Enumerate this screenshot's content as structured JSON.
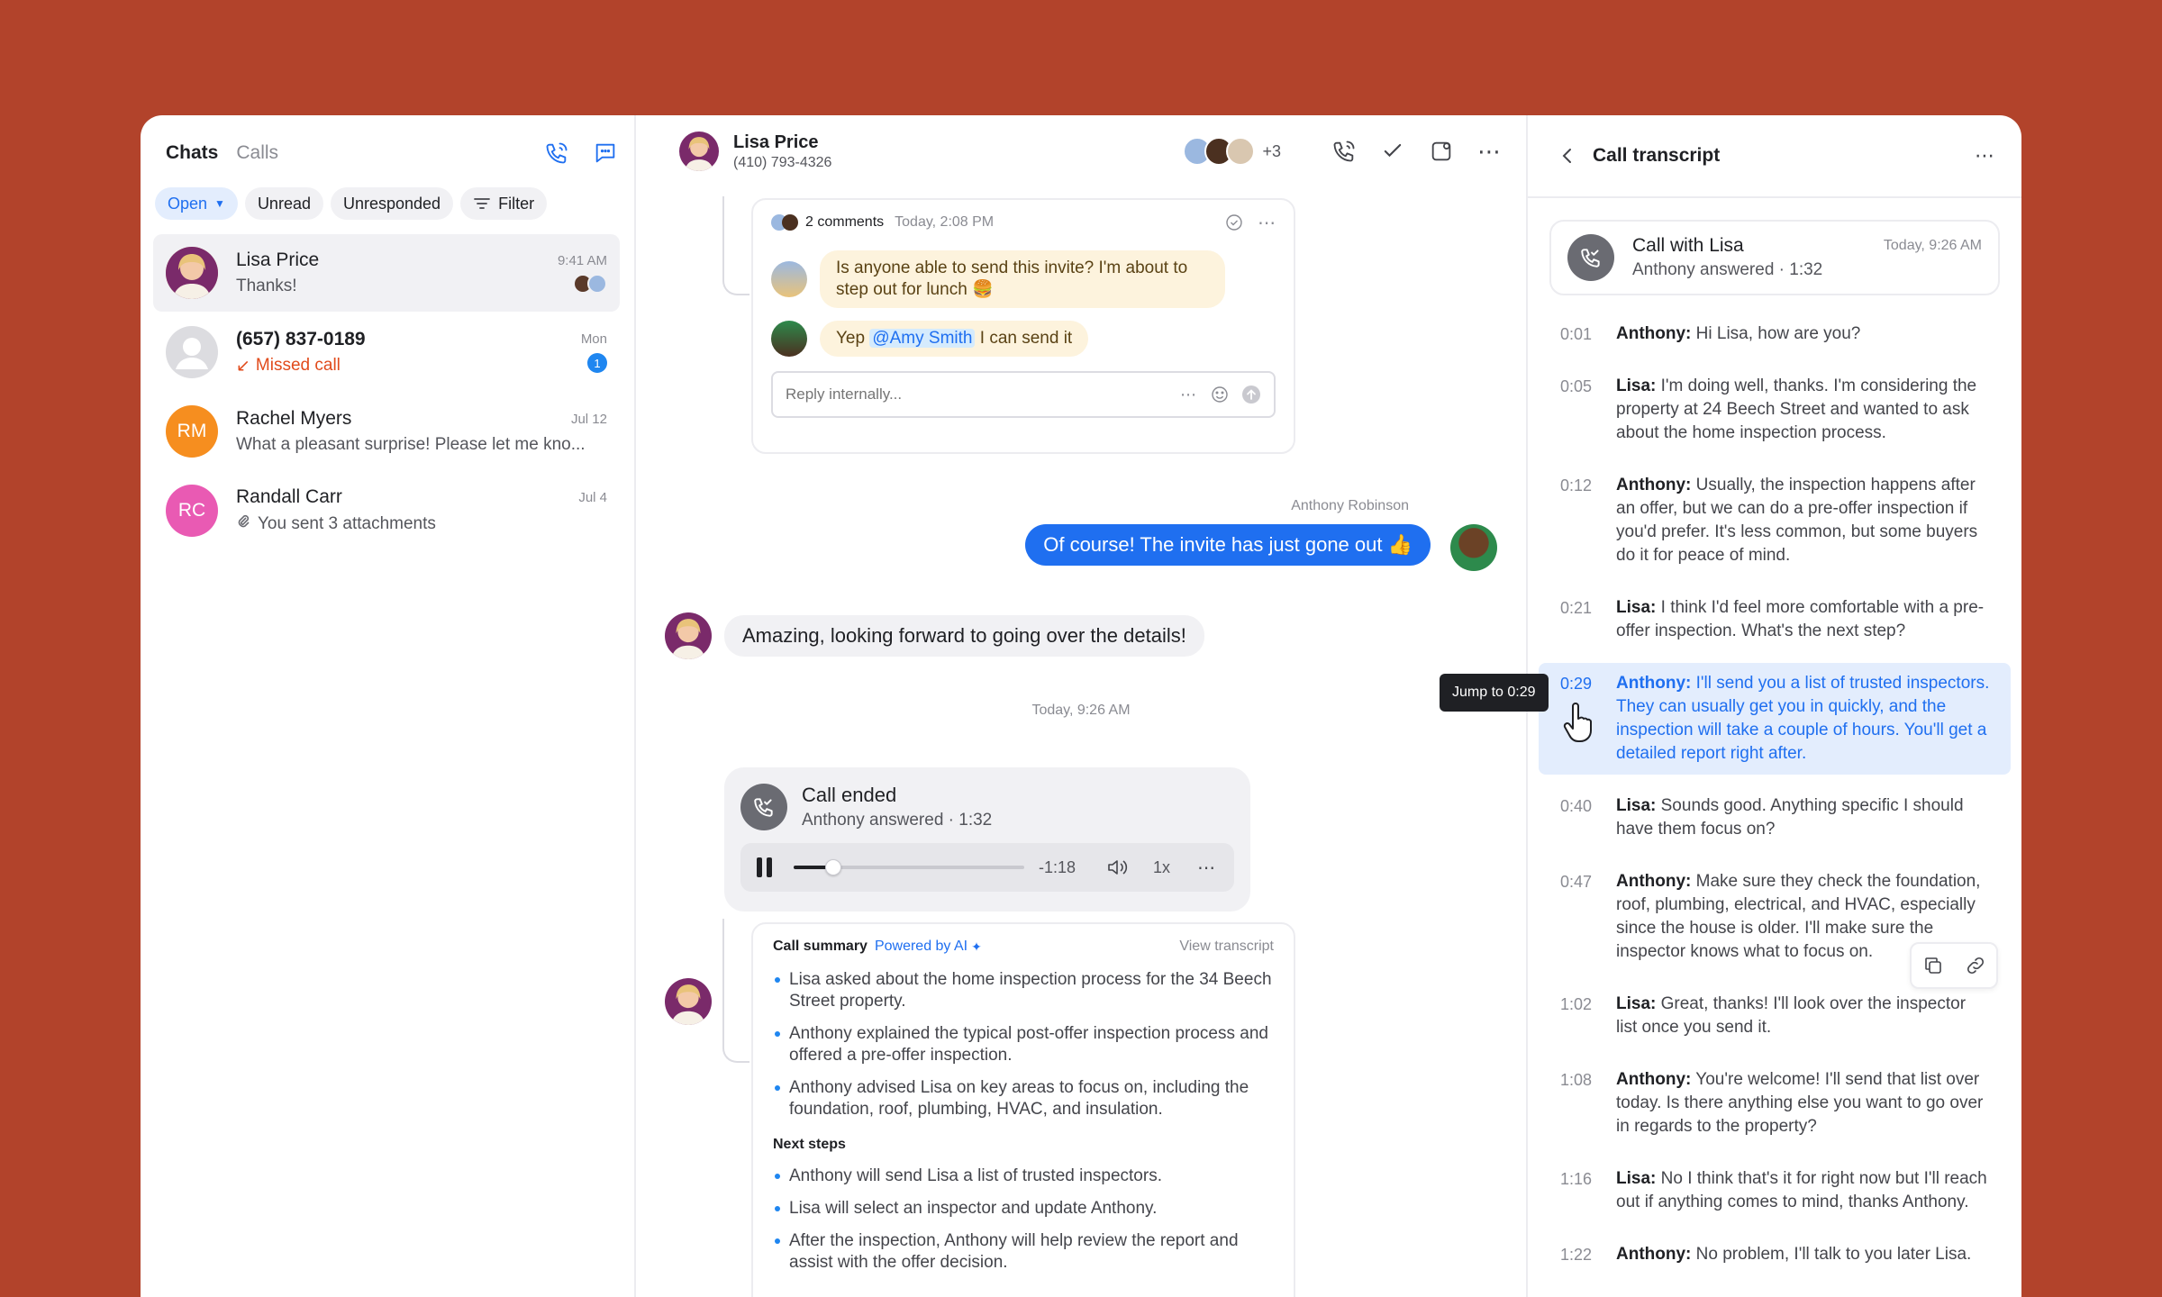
{
  "sidebar": {
    "tabs": [
      {
        "label": "Chats"
      },
      {
        "label": "Calls"
      }
    ],
    "filters": [
      {
        "label": "Open"
      },
      {
        "label": "Unread"
      },
      {
        "label": "Unresponded"
      },
      {
        "label": "Filter"
      }
    ],
    "conversations": [
      {
        "name": "Lisa Price",
        "time": "9:41 AM",
        "preview": "Thanks!"
      },
      {
        "name": "(657) 837-0189",
        "time": "Mon",
        "preview": "Missed call",
        "badge": "1"
      },
      {
        "name": "Rachel Myers",
        "initials": "RM",
        "time": "Jul 12",
        "preview": "What a pleasant surprise! Please let me kno..."
      },
      {
        "name": "Randall Carr",
        "initials": "RC",
        "time": "Jul 4",
        "preview": "You sent 3 attachments"
      }
    ]
  },
  "chat": {
    "contact_name": "Lisa Price",
    "contact_phone": "(410) 793-4326",
    "participants_more": "+3",
    "comments": {
      "count_label": "2 comments",
      "time": "Today, 2:08 PM",
      "items": [
        {
          "text": "Is anyone able to send this invite? I'm about to step out for lunch 🍔"
        },
        {
          "pre": "Yep ",
          "mention": "@Amy Smith",
          "post": " I can send it"
        }
      ],
      "reply_placeholder": "Reply internally..."
    },
    "outgoing_sender": "Anthony Robinson",
    "outgoing_message": "Of course! The invite has just gone out 👍",
    "incoming_message": "Amazing, looking forward to going over the details!",
    "divider_time": "Today, 9:26 AM",
    "call": {
      "title": "Call ended",
      "subtitle": "Anthony answered · 1:32",
      "remaining": "-1:18",
      "speed": "1x",
      "progress": 0.17
    },
    "summary": {
      "title": "Call summary",
      "powered": "Powered by AI",
      "view_link": "View transcript",
      "points": [
        "Lisa asked about the home inspection process for the 34 Beech Street property.",
        "Anthony explained the typical post-offer inspection process and offered a pre-offer inspection.",
        "Anthony advised Lisa on key areas to focus on, including the foundation, roof, plumbing, HVAC, and insulation."
      ],
      "next_title": "Next steps",
      "next_steps": [
        "Anthony will send Lisa a list of trusted inspectors.",
        "Lisa will select an inspector and update Anthony.",
        "After the inspection, Anthony will help review the report and assist with the offer decision."
      ]
    }
  },
  "transcript": {
    "title": "Call transcript",
    "call_title": "Call with Lisa",
    "call_time": "Today, 9:26 AM",
    "call_subtitle": "Anthony answered · 1:32",
    "tooltip": "Jump to 0:29",
    "lines": [
      {
        "time": "0:01",
        "speaker": "Anthony:",
        "text": " Hi Lisa, how are you?"
      },
      {
        "time": "0:05",
        "speaker": "Lisa:",
        "text": " I'm doing well, thanks. I'm considering the property at 24 Beech Street and wanted to ask about the home inspection process."
      },
      {
        "time": "0:12",
        "speaker": "Anthony:",
        "text": " Usually, the inspection happens after an offer, but we can do a pre-offer inspection if you'd prefer. It's less common, but some buyers do it for peace of mind."
      },
      {
        "time": "0:21",
        "speaker": "Lisa:",
        "text": " I think I'd feel more comfortable with a pre-offer inspection. What's the next step?"
      },
      {
        "time": "0:29",
        "speaker": "Anthony:",
        "text": " I'll send you a list of trusted inspectors. They can usually get you in quickly, and the inspection will take a couple of hours. You'll get a detailed report right after."
      },
      {
        "time": "0:40",
        "speaker": "Lisa:",
        "text": " Sounds good. Anything specific I should have them focus on?"
      },
      {
        "time": "0:47",
        "speaker": "Anthony:",
        "text": " Make sure they check the foundation, roof, plumbing, electrical, and HVAC, especially since the house is older. I'll make sure the inspector knows what to focus on."
      },
      {
        "time": "1:02",
        "speaker": "Lisa:",
        "text": " Great, thanks! I'll look over the inspector list once you send it."
      },
      {
        "time": "1:08",
        "speaker": "Anthony:",
        "text": " You're welcome! I'll send that list over today. Is there anything else you want to go over in regards to the property?"
      },
      {
        "time": "1:16",
        "speaker": "Lisa:",
        "text": " No I think that's it for right now but I'll reach out if anything comes to mind, thanks Anthony."
      },
      {
        "time": "1:22",
        "speaker": "Anthony:",
        "text": " No problem, I'll talk to you later Lisa."
      }
    ]
  },
  "colors": {
    "background": "#b2432b",
    "accent": "#1f6ff0",
    "missed": "#e14b1c",
    "highlight": "#e3edfd"
  }
}
